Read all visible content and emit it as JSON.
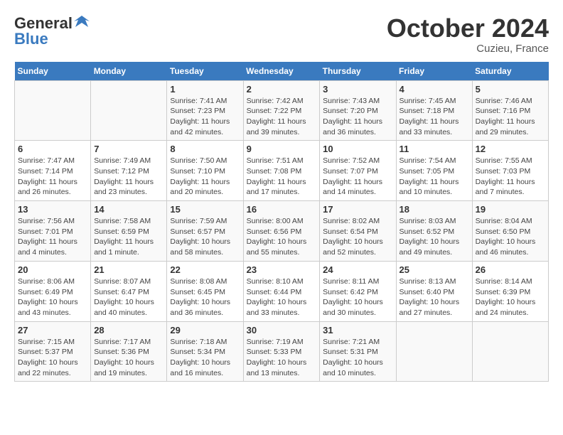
{
  "header": {
    "logo_general": "General",
    "logo_blue": "Blue",
    "month_title": "October 2024",
    "location": "Cuzieu, France"
  },
  "days_of_week": [
    "Sunday",
    "Monday",
    "Tuesday",
    "Wednesday",
    "Thursday",
    "Friday",
    "Saturday"
  ],
  "weeks": [
    [
      {
        "day": "",
        "sunrise": "",
        "sunset": "",
        "daylight": ""
      },
      {
        "day": "",
        "sunrise": "",
        "sunset": "",
        "daylight": ""
      },
      {
        "day": "1",
        "sunrise": "Sunrise: 7:41 AM",
        "sunset": "Sunset: 7:23 PM",
        "daylight": "Daylight: 11 hours and 42 minutes."
      },
      {
        "day": "2",
        "sunrise": "Sunrise: 7:42 AM",
        "sunset": "Sunset: 7:22 PM",
        "daylight": "Daylight: 11 hours and 39 minutes."
      },
      {
        "day": "3",
        "sunrise": "Sunrise: 7:43 AM",
        "sunset": "Sunset: 7:20 PM",
        "daylight": "Daylight: 11 hours and 36 minutes."
      },
      {
        "day": "4",
        "sunrise": "Sunrise: 7:45 AM",
        "sunset": "Sunset: 7:18 PM",
        "daylight": "Daylight: 11 hours and 33 minutes."
      },
      {
        "day": "5",
        "sunrise": "Sunrise: 7:46 AM",
        "sunset": "Sunset: 7:16 PM",
        "daylight": "Daylight: 11 hours and 29 minutes."
      }
    ],
    [
      {
        "day": "6",
        "sunrise": "Sunrise: 7:47 AM",
        "sunset": "Sunset: 7:14 PM",
        "daylight": "Daylight: 11 hours and 26 minutes."
      },
      {
        "day": "7",
        "sunrise": "Sunrise: 7:49 AM",
        "sunset": "Sunset: 7:12 PM",
        "daylight": "Daylight: 11 hours and 23 minutes."
      },
      {
        "day": "8",
        "sunrise": "Sunrise: 7:50 AM",
        "sunset": "Sunset: 7:10 PM",
        "daylight": "Daylight: 11 hours and 20 minutes."
      },
      {
        "day": "9",
        "sunrise": "Sunrise: 7:51 AM",
        "sunset": "Sunset: 7:08 PM",
        "daylight": "Daylight: 11 hours and 17 minutes."
      },
      {
        "day": "10",
        "sunrise": "Sunrise: 7:52 AM",
        "sunset": "Sunset: 7:07 PM",
        "daylight": "Daylight: 11 hours and 14 minutes."
      },
      {
        "day": "11",
        "sunrise": "Sunrise: 7:54 AM",
        "sunset": "Sunset: 7:05 PM",
        "daylight": "Daylight: 11 hours and 10 minutes."
      },
      {
        "day": "12",
        "sunrise": "Sunrise: 7:55 AM",
        "sunset": "Sunset: 7:03 PM",
        "daylight": "Daylight: 11 hours and 7 minutes."
      }
    ],
    [
      {
        "day": "13",
        "sunrise": "Sunrise: 7:56 AM",
        "sunset": "Sunset: 7:01 PM",
        "daylight": "Daylight: 11 hours and 4 minutes."
      },
      {
        "day": "14",
        "sunrise": "Sunrise: 7:58 AM",
        "sunset": "Sunset: 6:59 PM",
        "daylight": "Daylight: 11 hours and 1 minute."
      },
      {
        "day": "15",
        "sunrise": "Sunrise: 7:59 AM",
        "sunset": "Sunset: 6:57 PM",
        "daylight": "Daylight: 10 hours and 58 minutes."
      },
      {
        "day": "16",
        "sunrise": "Sunrise: 8:00 AM",
        "sunset": "Sunset: 6:56 PM",
        "daylight": "Daylight: 10 hours and 55 minutes."
      },
      {
        "day": "17",
        "sunrise": "Sunrise: 8:02 AM",
        "sunset": "Sunset: 6:54 PM",
        "daylight": "Daylight: 10 hours and 52 minutes."
      },
      {
        "day": "18",
        "sunrise": "Sunrise: 8:03 AM",
        "sunset": "Sunset: 6:52 PM",
        "daylight": "Daylight: 10 hours and 49 minutes."
      },
      {
        "day": "19",
        "sunrise": "Sunrise: 8:04 AM",
        "sunset": "Sunset: 6:50 PM",
        "daylight": "Daylight: 10 hours and 46 minutes."
      }
    ],
    [
      {
        "day": "20",
        "sunrise": "Sunrise: 8:06 AM",
        "sunset": "Sunset: 6:49 PM",
        "daylight": "Daylight: 10 hours and 43 minutes."
      },
      {
        "day": "21",
        "sunrise": "Sunrise: 8:07 AM",
        "sunset": "Sunset: 6:47 PM",
        "daylight": "Daylight: 10 hours and 40 minutes."
      },
      {
        "day": "22",
        "sunrise": "Sunrise: 8:08 AM",
        "sunset": "Sunset: 6:45 PM",
        "daylight": "Daylight: 10 hours and 36 minutes."
      },
      {
        "day": "23",
        "sunrise": "Sunrise: 8:10 AM",
        "sunset": "Sunset: 6:44 PM",
        "daylight": "Daylight: 10 hours and 33 minutes."
      },
      {
        "day": "24",
        "sunrise": "Sunrise: 8:11 AM",
        "sunset": "Sunset: 6:42 PM",
        "daylight": "Daylight: 10 hours and 30 minutes."
      },
      {
        "day": "25",
        "sunrise": "Sunrise: 8:13 AM",
        "sunset": "Sunset: 6:40 PM",
        "daylight": "Daylight: 10 hours and 27 minutes."
      },
      {
        "day": "26",
        "sunrise": "Sunrise: 8:14 AM",
        "sunset": "Sunset: 6:39 PM",
        "daylight": "Daylight: 10 hours and 24 minutes."
      }
    ],
    [
      {
        "day": "27",
        "sunrise": "Sunrise: 7:15 AM",
        "sunset": "Sunset: 5:37 PM",
        "daylight": "Daylight: 10 hours and 22 minutes."
      },
      {
        "day": "28",
        "sunrise": "Sunrise: 7:17 AM",
        "sunset": "Sunset: 5:36 PM",
        "daylight": "Daylight: 10 hours and 19 minutes."
      },
      {
        "day": "29",
        "sunrise": "Sunrise: 7:18 AM",
        "sunset": "Sunset: 5:34 PM",
        "daylight": "Daylight: 10 hours and 16 minutes."
      },
      {
        "day": "30",
        "sunrise": "Sunrise: 7:19 AM",
        "sunset": "Sunset: 5:33 PM",
        "daylight": "Daylight: 10 hours and 13 minutes."
      },
      {
        "day": "31",
        "sunrise": "Sunrise: 7:21 AM",
        "sunset": "Sunset: 5:31 PM",
        "daylight": "Daylight: 10 hours and 10 minutes."
      },
      {
        "day": "",
        "sunrise": "",
        "sunset": "",
        "daylight": ""
      },
      {
        "day": "",
        "sunrise": "",
        "sunset": "",
        "daylight": ""
      }
    ]
  ]
}
